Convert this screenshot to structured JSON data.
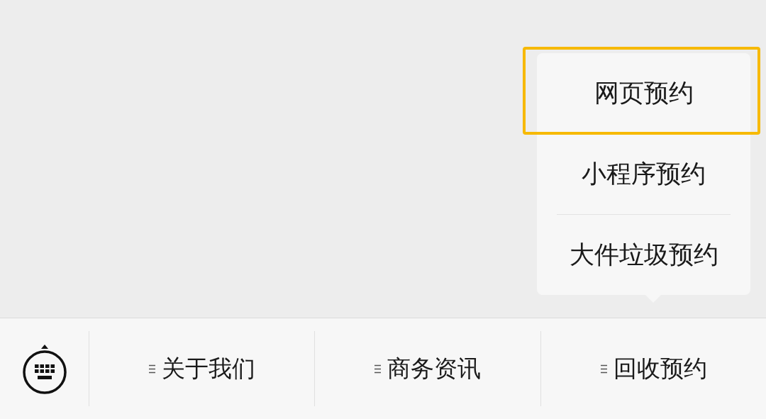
{
  "menu_bar": {
    "items": [
      {
        "label": "关于我们"
      },
      {
        "label": "商务资讯"
      },
      {
        "label": "回收预约",
        "submenu": [
          {
            "label": "网页预约",
            "highlighted": true
          },
          {
            "label": "小程序预约",
            "highlighted": false
          },
          {
            "label": "大件垃圾预约",
            "highlighted": false
          }
        ]
      }
    ]
  }
}
